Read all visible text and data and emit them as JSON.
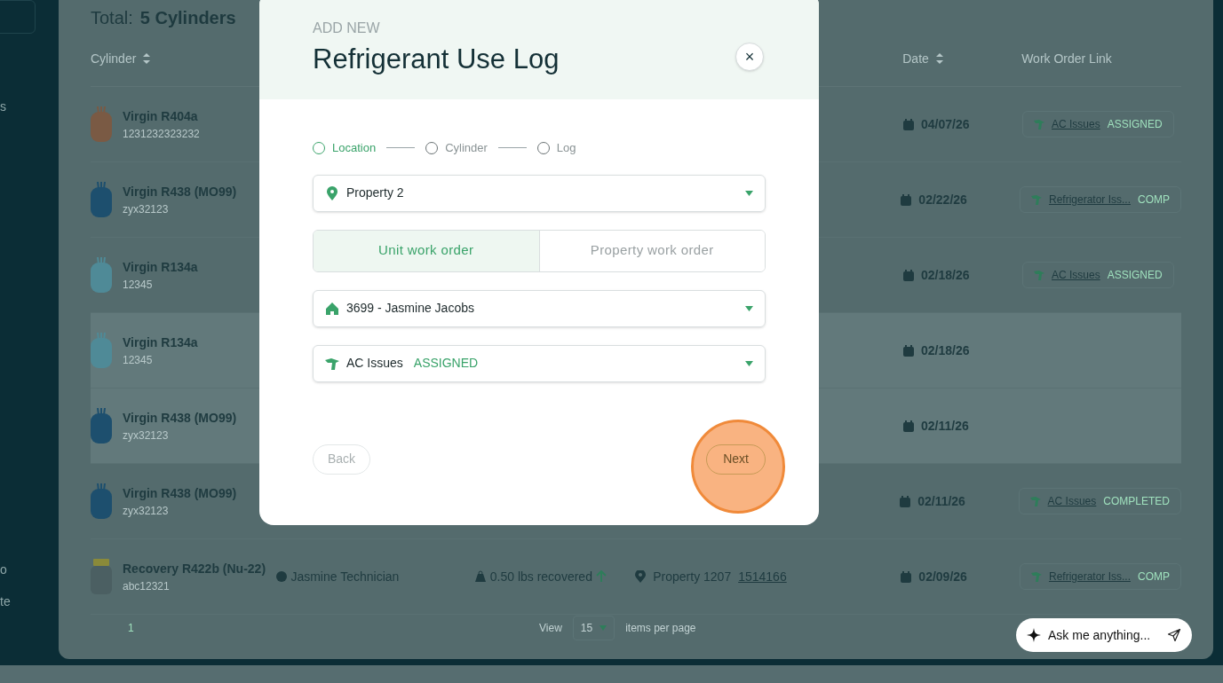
{
  "sidebar": {
    "items": [
      {
        "label": "s"
      },
      {
        "label": "o"
      },
      {
        "label": "te"
      }
    ]
  },
  "summary": {
    "label": "Total:",
    "value": "5 Cylinders"
  },
  "table": {
    "columns": [
      {
        "label": "Cylinder",
        "sortable": true
      },
      {
        "label": "Date",
        "sortable": true
      },
      {
        "label": "Work Order Link",
        "sortable": false
      }
    ],
    "rows": [
      {
        "name": "Virgin R404a",
        "serial": "1231232323232",
        "color": "#7a5a44",
        "kind": "virgin",
        "highlighted": false,
        "date": "04/07/26",
        "work_order": {
          "title": "AC Issues",
          "status": "ASSIGNED"
        }
      },
      {
        "name": "Virgin R438 (MO99)",
        "serial": "zyx32123",
        "color": "#1d4f6e",
        "kind": "virgin",
        "highlighted": false,
        "date": "02/22/26",
        "work_order": {
          "title": "Refrigerator Iss...",
          "status": "COMP"
        }
      },
      {
        "name": "Virgin R134a",
        "serial": "12345",
        "color": "#4f8a97",
        "kind": "virgin",
        "highlighted": false,
        "date": "02/18/26",
        "work_order": {
          "title": "AC Issues",
          "status": "ASSIGNED"
        }
      },
      {
        "name": "Virgin R134a",
        "serial": "12345",
        "color": "#4f8a97",
        "kind": "virgin",
        "highlighted": true,
        "date": "02/18/26"
      },
      {
        "name": "Virgin R438 (MO99)",
        "serial": "zyx32123",
        "color": "#1d4f6e",
        "kind": "virgin",
        "highlighted": true,
        "date": "02/11/26"
      },
      {
        "name": "Virgin R438 (MO99)",
        "serial": "zyx32123",
        "color": "#1d4f6e",
        "kind": "virgin",
        "highlighted": false,
        "date": "02/11/26",
        "work_order": {
          "title": "AC Issues",
          "status": "COMPLETED"
        }
      },
      {
        "name": "Recovery R422b (Nu-22)",
        "serial": "abc12321",
        "color": "#4b5f62",
        "kind": "recovery",
        "highlighted": false,
        "technician": "Jasmine Technician",
        "amount": "0.50 lbs recovered",
        "location": "Property 1207",
        "location_link": "1514166",
        "date": "02/09/26",
        "work_order": {
          "title": "Refrigerator Iss...",
          "status": "COMP"
        }
      }
    ]
  },
  "pagination": {
    "page": "1",
    "view_label": "View",
    "per_page": "15",
    "per_page_label": "items per page"
  },
  "modal": {
    "eyebrow": "ADD NEW",
    "title": "Refrigerant Use Log",
    "close": "×",
    "steps": [
      {
        "label": "Location",
        "selected": true
      },
      {
        "label": "Cylinder",
        "selected": false
      },
      {
        "label": "Log",
        "selected": false
      }
    ],
    "property": {
      "value": "Property 2"
    },
    "order_types": [
      {
        "label": "Unit work order",
        "selected": true
      },
      {
        "label": "Property work order",
        "selected": false
      }
    ],
    "unit": {
      "value": "3699 - Jasmine Jacobs"
    },
    "work_order": {
      "value": "AC Issues",
      "status": "ASSIGNED"
    },
    "back": "Back",
    "next": "Next",
    "next_highlighted": true
  },
  "assistant": {
    "placeholder": "Ask me anything..."
  }
}
